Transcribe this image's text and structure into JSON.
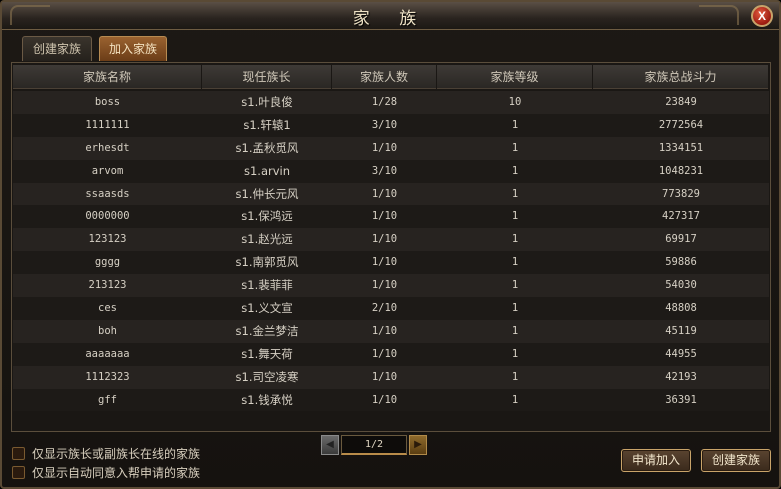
{
  "window": {
    "title": "家 族",
    "close_label": "X"
  },
  "tabs": [
    {
      "label": "创建家族",
      "active": false
    },
    {
      "label": "加入家族",
      "active": true
    }
  ],
  "table": {
    "headers": [
      "家族名称",
      "现任族长",
      "家族人数",
      "家族等级",
      "家族总战斗力"
    ],
    "rows": [
      [
        "boss",
        "s1.叶良俊",
        "1/28",
        "10",
        "23849"
      ],
      [
        "1111111",
        "s1.轩辕1",
        "3/10",
        "1",
        "2772564"
      ],
      [
        "erhesdt",
        "s1.孟秋觅风",
        "1/10",
        "1",
        "1334151"
      ],
      [
        "arvom",
        "s1.arvin",
        "3/10",
        "1",
        "1048231"
      ],
      [
        "ssaasds",
        "s1.仲长元风",
        "1/10",
        "1",
        "773829"
      ],
      [
        "0000000",
        "s1.保鸿远",
        "1/10",
        "1",
        "427317"
      ],
      [
        "123123",
        "s1.赵光远",
        "1/10",
        "1",
        "69917"
      ],
      [
        "gggg",
        "s1.南郭觅风",
        "1/10",
        "1",
        "59886"
      ],
      [
        "213123",
        "s1.裴菲菲",
        "1/10",
        "1",
        "54030"
      ],
      [
        "ces",
        "s1.义文宣",
        "2/10",
        "1",
        "48808"
      ],
      [
        "boh",
        "s1.金兰梦洁",
        "1/10",
        "1",
        "45119"
      ],
      [
        "aaaaaaa",
        "s1.舞天荷",
        "1/10",
        "1",
        "44955"
      ],
      [
        "1112323",
        "s1.司空凌寒",
        "1/10",
        "1",
        "42193"
      ],
      [
        "gff",
        "s1.钱承悦",
        "1/10",
        "1",
        "36391"
      ]
    ]
  },
  "filters": {
    "online_leaders_label": "仅显示族长或副族长在线的家族",
    "auto_accept_label": "仅显示自动同意入帮申请的家族"
  },
  "pager": {
    "value": "1/2",
    "prev_icon": "arrow-left-icon",
    "next_icon": "arrow-right-icon"
  },
  "buttons": {
    "apply_label": "申请加入",
    "create_label": "创建家族"
  }
}
